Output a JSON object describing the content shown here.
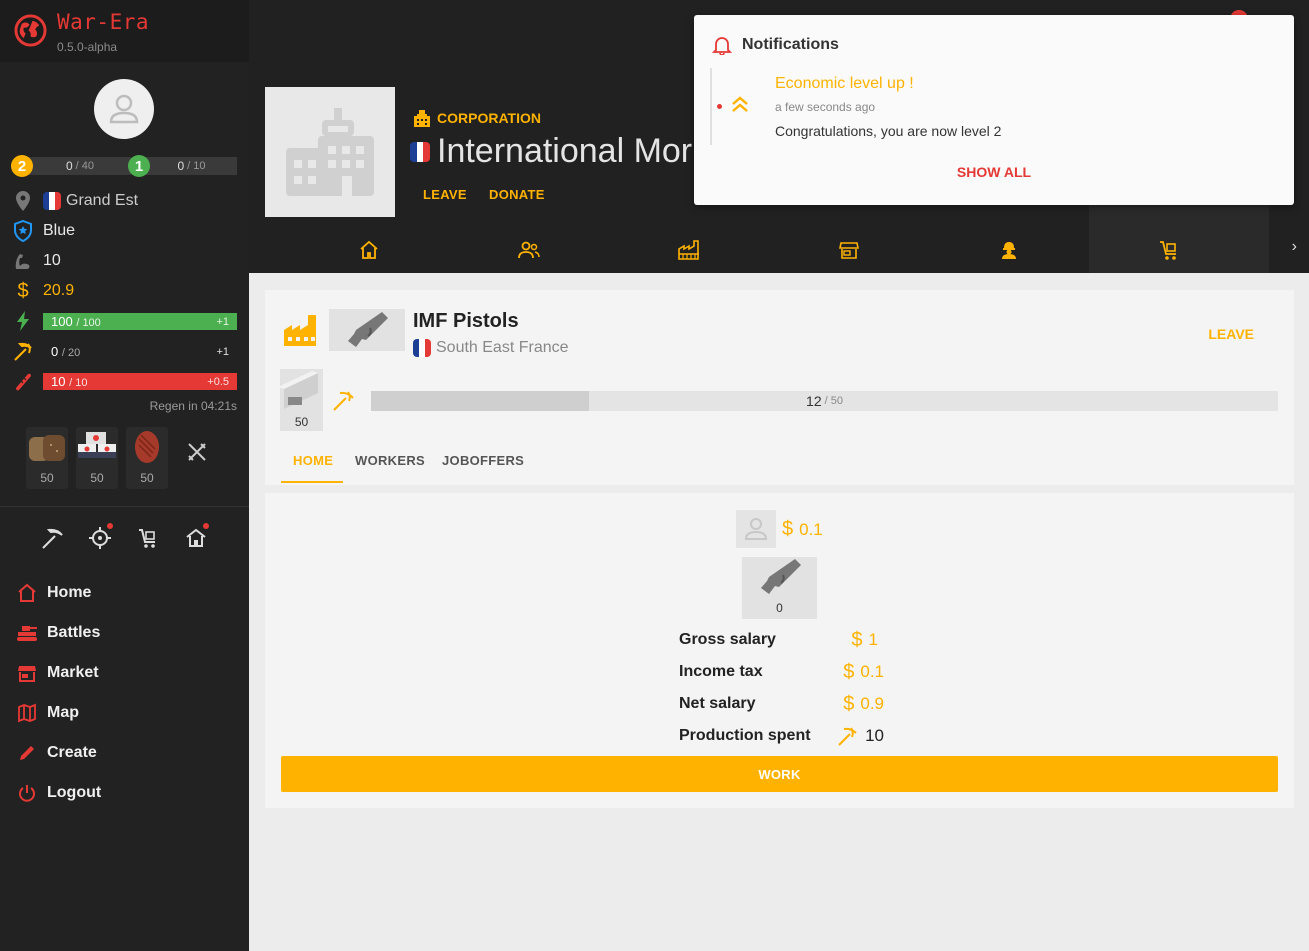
{
  "app": {
    "name": "War-Era",
    "version": "0.5.0-alpha"
  },
  "colors": {
    "accent": "#ffb300",
    "danger": "#e53935",
    "energy": "#4caf50",
    "sidebar": "#222222"
  },
  "profile": {
    "level": {
      "value": "2",
      "current": "0",
      "max": "/ 40"
    },
    "military": {
      "value": "1",
      "current": "0",
      "max": "/ 10"
    },
    "region": "Grand Est",
    "party": "Blue",
    "strength": "10",
    "money": "20.9",
    "energy": {
      "current": "100",
      "max": "/ 100",
      "regen": "+1",
      "fraction": 1.0
    },
    "production": {
      "current": "0",
      "max": "/ 20",
      "regen": "+1"
    },
    "hunger": {
      "current": "10",
      "max": "/ 10",
      "regen": "+0.5",
      "fraction": 1.0
    },
    "regen_text": "Regen in 04:21s",
    "food": [
      {
        "name": "bread-icon",
        "count": "50"
      },
      {
        "name": "sushi-icon",
        "count": "50"
      },
      {
        "name": "steak-icon",
        "count": "50"
      }
    ]
  },
  "quick_actions": [
    "pickaxe-icon",
    "crosshair-icon",
    "cart-icon",
    "house-icon"
  ],
  "nav": [
    {
      "label": "Home",
      "icon": "home-icon"
    },
    {
      "label": "Battles",
      "icon": "tank-icon"
    },
    {
      "label": "Market",
      "icon": "store-icon"
    },
    {
      "label": "Map",
      "icon": "map-icon"
    },
    {
      "label": "Create",
      "icon": "pencil-icon"
    },
    {
      "label": "Logout",
      "icon": "power-icon"
    }
  ],
  "corporation": {
    "label": "CORPORATION",
    "name": "International Mor",
    "leave": "LEAVE",
    "donate": "DONATE",
    "tabs": [
      "home-icon",
      "people-icon",
      "factory-icon",
      "store-icon",
      "worker-icon",
      "cart-icon"
    ]
  },
  "notifications": {
    "title": "Notifications",
    "item": {
      "title": "Economic level up !",
      "time": "a few seconds ago",
      "message": "Congratulations, you are now level 2"
    },
    "show_all": "SHOW ALL"
  },
  "company": {
    "name": "IMF Pistols",
    "region": "South East France",
    "leave": "LEAVE",
    "raw_count": "50",
    "progress": {
      "current": "12",
      "max": "/ 50",
      "fraction": 0.24
    },
    "tabs": [
      "HOME",
      "WORKERS",
      "JOBOFFERS"
    ]
  },
  "work": {
    "wage": "0.1",
    "item_count": "0",
    "gross_label": "Gross salary",
    "gross": "1",
    "tax_label": "Income tax",
    "tax": "0.1",
    "net_label": "Net salary",
    "net": "0.9",
    "spent_label": "Production spent",
    "spent": "10",
    "button": "WORK"
  }
}
